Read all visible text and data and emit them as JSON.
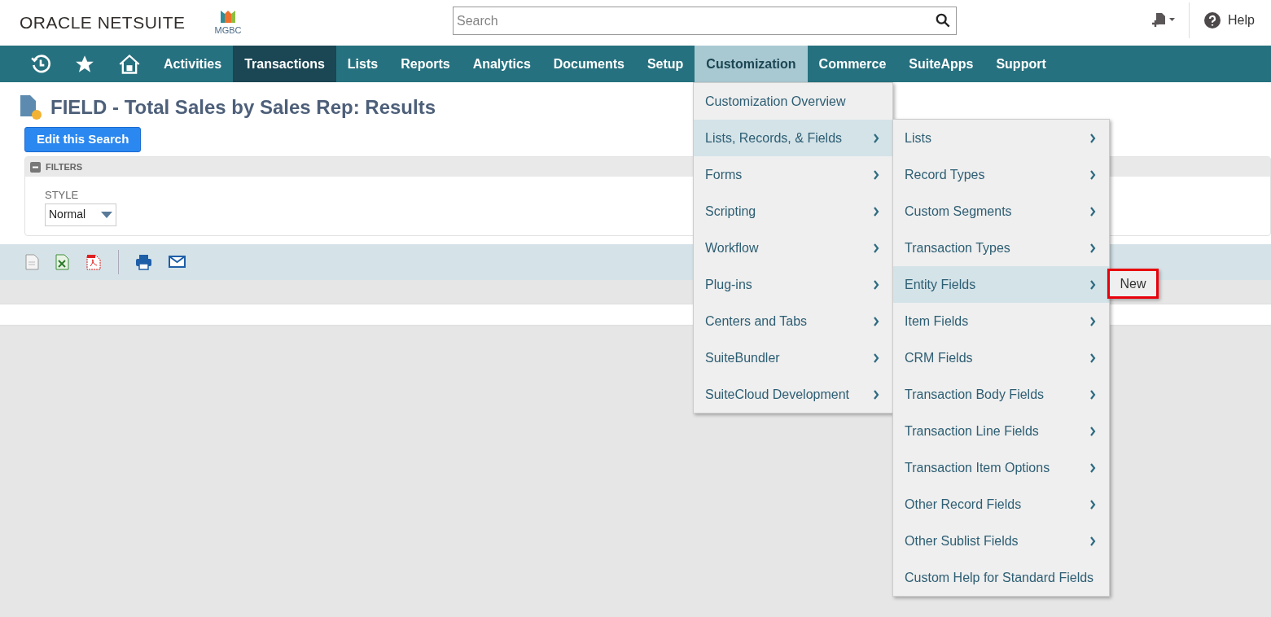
{
  "header": {
    "logo": "ORACLE NETSUITE",
    "company": "MGBC",
    "search": {
      "placeholder": "Search"
    },
    "help": "Help"
  },
  "nav": [
    {
      "kind": "icon",
      "selected": false
    },
    {
      "kind": "icon",
      "selected": false
    },
    {
      "kind": "icon",
      "selected": false
    },
    {
      "kind": "text",
      "label": "Activities",
      "selected": false
    },
    {
      "kind": "text",
      "label": "Transactions",
      "selected": true
    },
    {
      "kind": "text",
      "label": "Lists",
      "selected": false
    },
    {
      "kind": "text",
      "label": "Reports",
      "selected": false
    },
    {
      "kind": "text",
      "label": "Analytics",
      "selected": false
    },
    {
      "kind": "text",
      "label": "Documents",
      "selected": false
    },
    {
      "kind": "text",
      "label": "Setup",
      "selected": false
    },
    {
      "kind": "text",
      "label": "Customization",
      "selected": false,
      "expanded": true
    },
    {
      "kind": "text",
      "label": "Commerce",
      "selected": false
    },
    {
      "kind": "text",
      "label": "SuiteApps",
      "selected": false
    },
    {
      "kind": "text",
      "label": "Support",
      "selected": false
    }
  ],
  "page": {
    "title": "FIELD - Total Sales by Sales Rep: Results",
    "edit_button": "Edit this Search",
    "filters": {
      "heading": "FILTERS",
      "expanded": true,
      "style_label": "STYLE",
      "style_value": "Normal"
    }
  },
  "menu": [
    {
      "label": "Customization Overview",
      "submenu": false,
      "selected": false
    },
    {
      "label": "Lists, Records, & Fields",
      "submenu": true,
      "selected": true
    },
    {
      "label": "Forms",
      "submenu": true,
      "selected": false
    },
    {
      "label": "Scripting",
      "submenu": true,
      "selected": false
    },
    {
      "label": "Workflow",
      "submenu": true,
      "selected": false
    },
    {
      "label": "Plug-ins",
      "submenu": true,
      "selected": false
    },
    {
      "label": "Centers and Tabs",
      "submenu": true,
      "selected": false
    },
    {
      "label": "SuiteBundler",
      "submenu": true,
      "selected": false
    },
    {
      "label": "SuiteCloud Development",
      "submenu": true,
      "selected": false
    }
  ],
  "submenu": [
    {
      "label": "Lists",
      "submenu": true,
      "selected": false
    },
    {
      "label": "Record Types",
      "submenu": true,
      "selected": false
    },
    {
      "label": "Custom Segments",
      "submenu": true,
      "selected": false
    },
    {
      "label": "Transaction Types",
      "submenu": true,
      "selected": false
    },
    {
      "label": "Entity Fields",
      "submenu": true,
      "selected": true
    },
    {
      "label": "Item Fields",
      "submenu": true,
      "selected": false
    },
    {
      "label": "CRM Fields",
      "submenu": true,
      "selected": false
    },
    {
      "label": "Transaction Body Fields",
      "submenu": true,
      "selected": false
    },
    {
      "label": "Transaction Line Fields",
      "submenu": true,
      "selected": false
    },
    {
      "label": "Transaction Item Options",
      "submenu": true,
      "selected": false
    },
    {
      "label": "Other Record Fields",
      "submenu": true,
      "selected": false
    },
    {
      "label": "Other Sublist Fields",
      "submenu": true,
      "selected": false
    },
    {
      "label": "Custom Help for Standard Fields",
      "submenu": false,
      "selected": false
    }
  ],
  "flyout": [
    {
      "label": "New",
      "highlighted": true
    }
  ]
}
